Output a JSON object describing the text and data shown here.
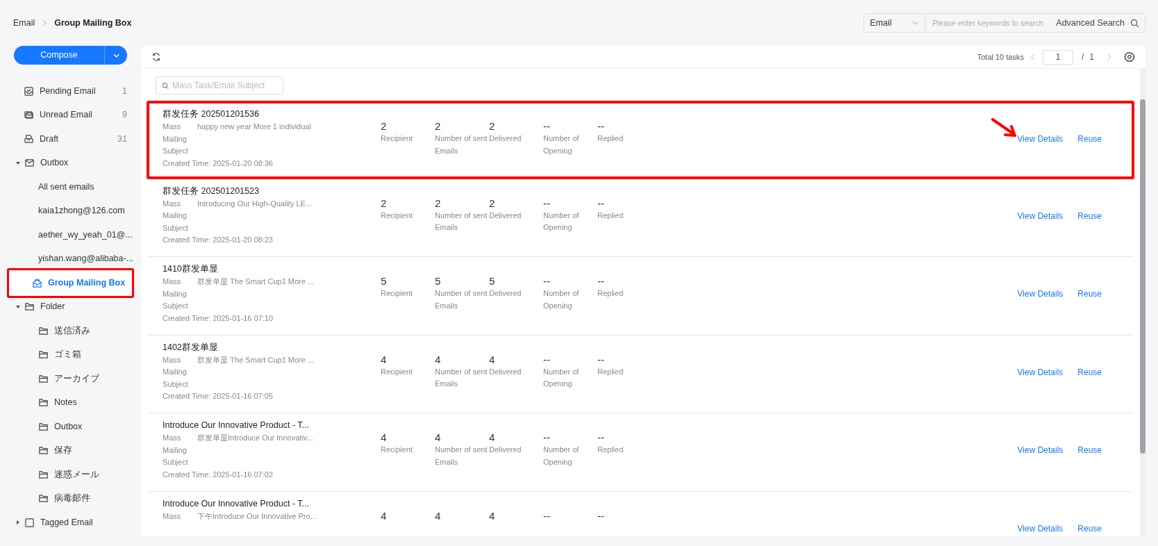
{
  "breadcrumb": [
    {
      "label": "Email"
    },
    {
      "label": "Group Mailing Box"
    }
  ],
  "top_search": {
    "scope": "Email",
    "placeholder": "Please enter keywords to search",
    "advanced": "Advanced Search"
  },
  "sidebar": {
    "compose": {
      "label": "Compose"
    },
    "items": [
      {
        "kind": "pending",
        "label": "Pending Email",
        "count": "1",
        "selected": false,
        "highlighted": false
      },
      {
        "kind": "unread",
        "label": "Unread Email",
        "count": "9",
        "selected": false,
        "highlighted": false
      },
      {
        "kind": "draft",
        "label": "Draft",
        "count": "31",
        "selected": false,
        "highlighted": false
      },
      {
        "kind": "outbox",
        "label": "Outbox",
        "expanded": true,
        "selected": false,
        "highlighted": false,
        "children": [
          {
            "kind": "account",
            "label": "All sent emails",
            "selected": false
          },
          {
            "kind": "account",
            "label": "kaia1zhong@126.com",
            "selected": false
          },
          {
            "kind": "account",
            "label": "aether_wy_yeah_01@...",
            "selected": false
          },
          {
            "kind": "account",
            "label": "yishan.wang@alibaba-...",
            "selected": false
          }
        ]
      },
      {
        "kind": "group",
        "label": "Group Mailing Box",
        "selected": true,
        "highlighted": true
      },
      {
        "kind": "folder",
        "label": "Folder",
        "expanded": true,
        "selected": false,
        "highlighted": false,
        "children": [
          {
            "kind": "folder",
            "label": "送信済み",
            "selected": false
          },
          {
            "kind": "folder",
            "label": "ゴミ箱",
            "selected": false
          },
          {
            "kind": "folder",
            "label": "アーカイブ",
            "selected": false
          },
          {
            "kind": "folder",
            "label": "Notes",
            "selected": false
          },
          {
            "kind": "folder",
            "label": "Outbox",
            "selected": false
          },
          {
            "kind": "folder",
            "label": "保存",
            "selected": false
          },
          {
            "kind": "folder",
            "label": "迷惑メール",
            "selected": false
          },
          {
            "kind": "folder",
            "label": "病毒邮件",
            "selected": false
          }
        ]
      },
      {
        "kind": "tag",
        "label": "Tagged Email",
        "expanded": false,
        "selected": false,
        "highlighted": false
      }
    ]
  },
  "toolbar": {
    "total": "Total 10 tasks",
    "page": "1",
    "separator": "/",
    "pages": "1"
  },
  "task_search": {
    "placeholder": "Mass Task/Email Subject"
  },
  "tasks": [
    {
      "title": "群发任务 202501201536",
      "subject_label": [
        "Mass",
        "Mailing",
        "Subject"
      ],
      "subject": "happy  new  year More 1 individual",
      "created": "Created Time: 2025-01-20 08:36",
      "stats": [
        {
          "value": "2",
          "label": "Recipient"
        },
        {
          "value": "2",
          "label": "Number of sent Emails"
        },
        {
          "value": "2",
          "label": "Delivered"
        },
        {
          "value": "--",
          "label": "Number of Opening"
        },
        {
          "value": "--",
          "label": "Replied"
        }
      ],
      "actions": [
        "View Details",
        "Reuse"
      ],
      "highlighted": true
    },
    {
      "title": "群发任务 202501201523",
      "subject_label": [
        "Mass",
        "Mailing",
        "Subject"
      ],
      "subject": "Introducing Our High-Quality LE...",
      "created": "Created Time: 2025-01-20 08:23",
      "stats": [
        {
          "value": "2",
          "label": "Recipient"
        },
        {
          "value": "2",
          "label": "Number of sent Emails"
        },
        {
          "value": "2",
          "label": "Delivered"
        },
        {
          "value": "--",
          "label": "Number of Opening"
        },
        {
          "value": "--",
          "label": "Replied"
        }
      ],
      "actions": [
        "View Details",
        "Reuse"
      ],
      "highlighted": false
    },
    {
      "title": "1410群发单显",
      "subject_label": [
        "Mass",
        "Mailing",
        "Subject"
      ],
      "subject": "群发单显 The Smart Cup1 More ...",
      "created": "Created Time: 2025-01-16 07:10",
      "stats": [
        {
          "value": "5",
          "label": "Recipient"
        },
        {
          "value": "5",
          "label": "Number of sent Emails"
        },
        {
          "value": "5",
          "label": "Delivered"
        },
        {
          "value": "--",
          "label": "Number of Opening"
        },
        {
          "value": "--",
          "label": "Replied"
        }
      ],
      "actions": [
        "View Details",
        "Reuse"
      ],
      "highlighted": false
    },
    {
      "title": "1402群发单显",
      "subject_label": [
        "Mass",
        "Mailing",
        "Subject"
      ],
      "subject": "群发单显 The Smart Cup1 More ...",
      "created": "Created Time: 2025-01-16 07:05",
      "stats": [
        {
          "value": "4",
          "label": "Recipient"
        },
        {
          "value": "4",
          "label": "Number of sent Emails"
        },
        {
          "value": "4",
          "label": "Delivered"
        },
        {
          "value": "--",
          "label": "Number of Opening"
        },
        {
          "value": "--",
          "label": "Replied"
        }
      ],
      "actions": [
        "View Details",
        "Reuse"
      ],
      "highlighted": false
    },
    {
      "title": "Introduce Our Innovative Product - T...",
      "subject_label": [
        "Mass",
        "Mailing",
        "Subject"
      ],
      "subject": "群发单显Introduce Our Innovativ...",
      "created": "Created Time: 2025-01-16 07:02",
      "stats": [
        {
          "value": "4",
          "label": "Recipient"
        },
        {
          "value": "4",
          "label": "Number of sent Emails"
        },
        {
          "value": "4",
          "label": "Delivered"
        },
        {
          "value": "--",
          "label": "Number of Opening"
        },
        {
          "value": "--",
          "label": "Replied"
        }
      ],
      "actions": [
        "View Details",
        "Reuse"
      ],
      "highlighted": false
    },
    {
      "title": "Introduce Our Innovative Product - T...",
      "subject_label": [
        "Mass"
      ],
      "subject": "下午Introduce Our Innovative Pro...",
      "stats": [
        {
          "value": "4"
        },
        {
          "value": "4"
        },
        {
          "value": "4"
        },
        {
          "value": "--"
        },
        {
          "value": "--"
        }
      ],
      "actions": [
        "View Details",
        "Reuse"
      ],
      "highlighted": false
    }
  ]
}
